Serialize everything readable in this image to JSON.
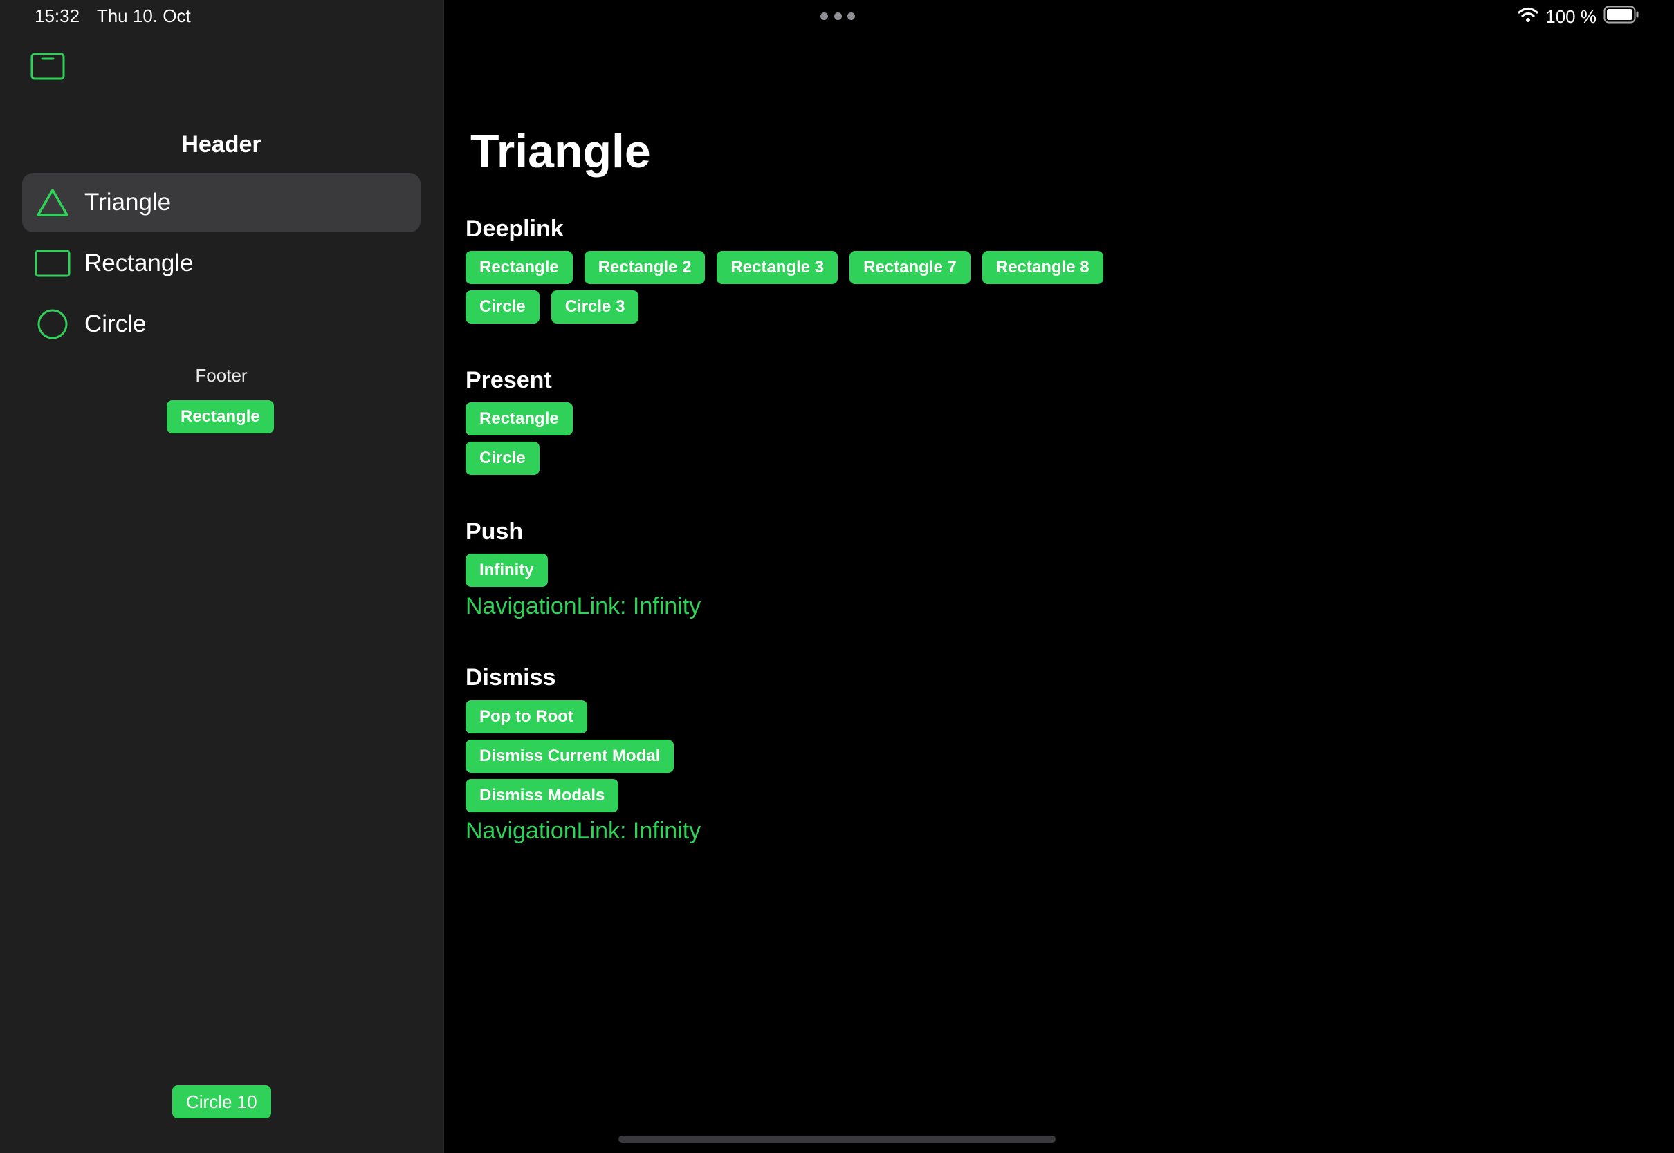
{
  "status": {
    "time": "15:32",
    "date": "Thu 10. Oct",
    "battery": "100 %"
  },
  "sidebar": {
    "header": "Header",
    "items": [
      {
        "label": "Triangle",
        "icon": "triangle-icon",
        "selected": true
      },
      {
        "label": "Rectangle",
        "icon": "rectangle-icon",
        "selected": false
      },
      {
        "label": "Circle",
        "icon": "circle-icon",
        "selected": false
      }
    ],
    "footer": "Footer",
    "footer_button": "Rectangle",
    "bottom_button": "Circle 10"
  },
  "main": {
    "title": "Triangle",
    "deeplink": {
      "title": "Deeplink",
      "row1": [
        "Rectangle",
        "Rectangle 2",
        "Rectangle 3",
        "Rectangle 7",
        "Rectangle 8"
      ],
      "row2": [
        "Circle",
        "Circle 3"
      ]
    },
    "present": {
      "title": "Present",
      "buttons": [
        "Rectangle",
        "Circle"
      ]
    },
    "push": {
      "title": "Push",
      "button": "Infinity",
      "link": "NavigationLink: Infinity"
    },
    "dismiss": {
      "title": "Dismiss",
      "buttons": [
        "Pop to Root",
        "Dismiss Current Modal",
        "Dismiss Modals"
      ],
      "link": "NavigationLink: Infinity"
    }
  },
  "colors": {
    "accent": "#30d158",
    "sidebar_bg": "#1f1f1f",
    "selected_bg": "#3a3a3c"
  }
}
